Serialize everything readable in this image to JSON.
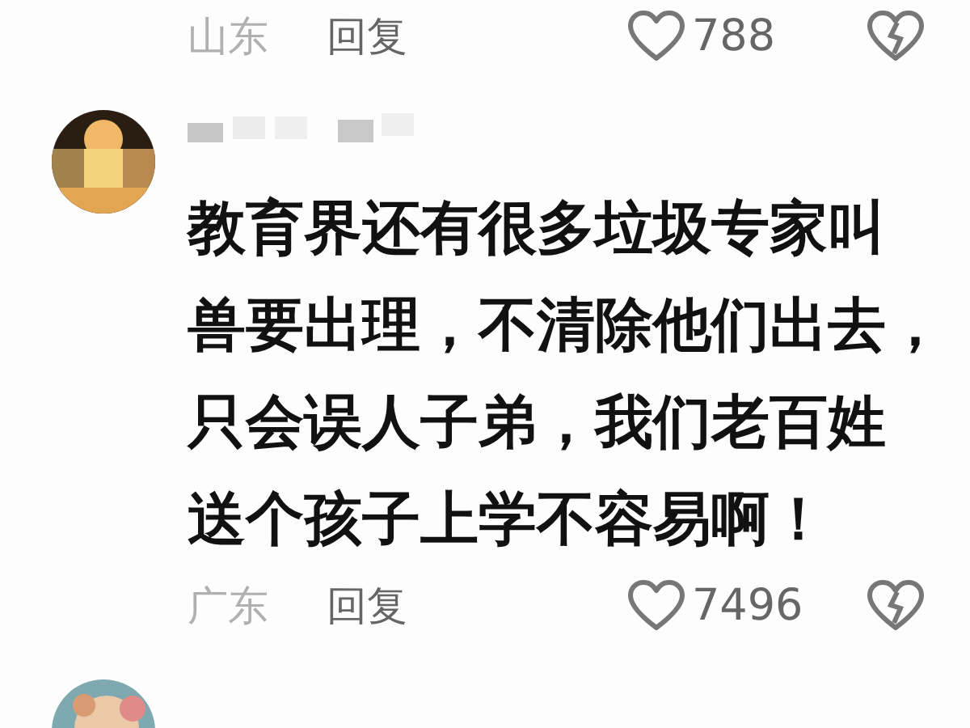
{
  "comments": [
    {
      "region": "山东",
      "reply": "回复",
      "likes": "788"
    },
    {
      "avatar": {
        "kind": "picture"
      },
      "name_hidden": true,
      "lines": [
        "教育界还有很多垃圾专家叫",
        "兽要出理，不清除他们出去，",
        "只会误人子弟，我们老百姓",
        "送个孩子上学不容易啊！"
      ],
      "region": "广东",
      "reply": "回复",
      "likes": "7496"
    },
    {
      "avatar": {
        "kind": "picture"
      }
    }
  ]
}
